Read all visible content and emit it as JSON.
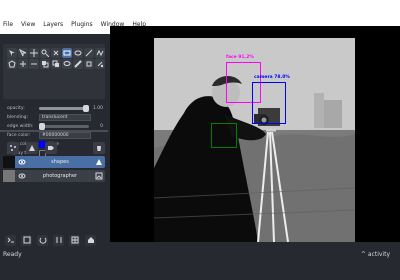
{
  "menubar": {
    "items": [
      "File",
      "View",
      "Layers",
      "Plugins",
      "Window",
      "Help"
    ]
  },
  "controls": {
    "opacity_label": "opacity:",
    "opacity_value": "1.00",
    "blending_label": "blending:",
    "blending_value": "translucent",
    "edge_width_label": "edge width:",
    "edge_width_value": "0",
    "face_color_label": "face color:",
    "face_color_value": "#00000000",
    "edge_color_label": "edge color:",
    "edge_color_name": "blue",
    "display_text_label": "display text:"
  },
  "layers": [
    {
      "name": "shapes",
      "selected": true,
      "kind_icon": "shapes-icon"
    },
    {
      "name": "photographer",
      "selected": false,
      "kind_icon": "image-icon"
    }
  ],
  "status": {
    "left": "Ready",
    "right": "activity"
  },
  "bboxes": [
    {
      "label": "face 91.2%",
      "color": "#ff00ff"
    },
    {
      "label": "camera 78.0%",
      "color": "#0000ff"
    },
    {
      "label": "",
      "color": "#008000"
    }
  ],
  "colors": {
    "panel": "#262930",
    "accent": "#4a6fa5",
    "blue": "#0000ff",
    "magenta": "#ff00ff",
    "green": "#008000"
  },
  "icons": {
    "tool_icons": [
      "select-icon",
      "direct-select-icon",
      "pan-icon",
      "zoom-icon",
      "transform-icon",
      "add-rectangle-icon",
      "add-ellipse-icon",
      "add-line-icon",
      "add-path-icon",
      "polygon-icon",
      "vertex-add-icon",
      "vertex-remove-icon",
      "move-front-icon",
      "move-back-icon",
      "lasso-icon",
      "paint-icon",
      "erase-icon",
      "fill-icon"
    ],
    "layer_tools": [
      "points-icon",
      "shapes-icon",
      "labels-icon",
      "trash-icon"
    ],
    "bottom_tools": [
      "console-icon",
      "ndisplay-icon",
      "roll-icon",
      "transpose-icon",
      "grid-icon",
      "home-icon"
    ]
  }
}
